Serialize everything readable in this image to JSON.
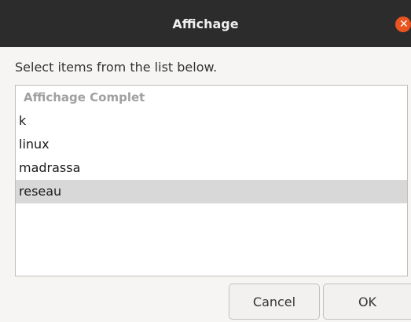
{
  "window": {
    "title": "Affichage"
  },
  "dialog": {
    "prompt": "Select items from the list below.",
    "list": {
      "header": "Affichage Complet",
      "items": [
        {
          "label": "k",
          "selected": false
        },
        {
          "label": "linux",
          "selected": false
        },
        {
          "label": "madrassa",
          "selected": false
        },
        {
          "label": "reseau",
          "selected": true
        }
      ]
    },
    "buttons": {
      "cancel": "Cancel",
      "ok": "OK"
    }
  },
  "icons": {
    "close": "close-icon"
  },
  "colors": {
    "titlebar": "#2c2c2c",
    "close_button": "#e95420",
    "selection": "#d8d8d8"
  }
}
